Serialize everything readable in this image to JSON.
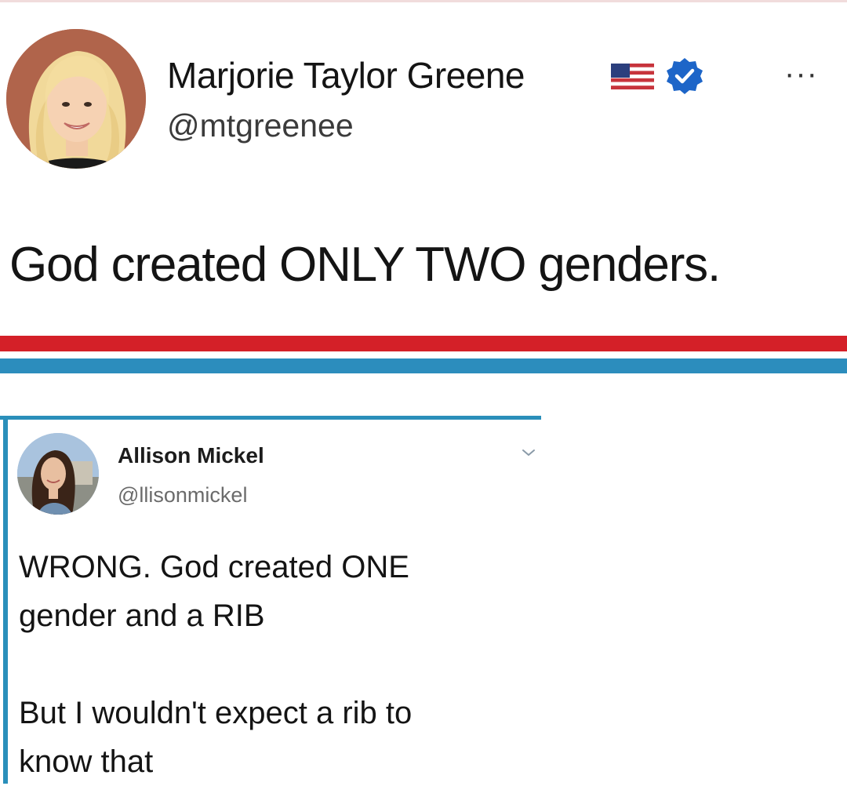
{
  "main_tweet": {
    "author_name": "Marjorie Taylor Greene",
    "author_handle": "@mtgreenee",
    "text": "God created ONLY TWO genders.",
    "more_label": "···",
    "icons": [
      "flag-icon",
      "verified-badge-icon",
      "more-options-icon"
    ],
    "colors": {
      "verified": "#1d65c8",
      "accent_red": "#d42028",
      "accent_blue": "#2c8dbd"
    }
  },
  "reply_tweet": {
    "author_name": "Allison Mickel",
    "author_handle": "@llisonmickel",
    "line1": "WRONG. God created ONE",
    "line2": "gender and a RIB",
    "line3": "But I wouldn't expect a rib to",
    "line4": "know that",
    "icons": [
      "chevron-down-icon"
    ],
    "colors": {
      "border": "#2a8fba"
    }
  }
}
